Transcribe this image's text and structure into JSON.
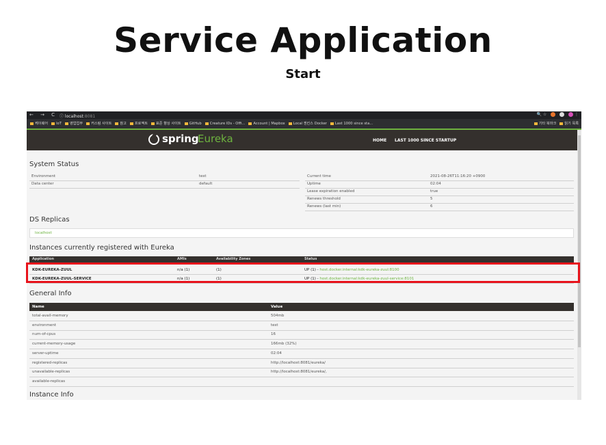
{
  "slide": {
    "title": "Service Application",
    "subtitle": "Start"
  },
  "browser": {
    "nav_glyphs": "← → C",
    "url_host": "localhost",
    "url_port": ":8081",
    "right_glyphs": "🔍 ☆",
    "bookmarks": [
      "케이웨어",
      "IoT",
      "영업업무",
      "커스텀 사이트",
      "참고",
      "프로젝트",
      "표준 향상 사이트",
      "GitHub",
      "Creature IDs - Offi...",
      "Account | Mapbox",
      "Local 젠킨스 Docker",
      "Last 1000 since sta..."
    ],
    "bookmarks_right": [
      "기타 북마크",
      "읽기 목록"
    ],
    "colors": {
      "folder": "#f6b93b",
      "accent": "#6db33f"
    }
  },
  "eureka": {
    "logo_spring": "spring",
    "logo_eureka": "Eureka",
    "nav": [
      "HOME",
      "LAST 1000 SINCE STARTUP"
    ],
    "system_status": {
      "heading": "System Status",
      "left": [
        {
          "key": "Environment",
          "value": "test"
        },
        {
          "key": "Data center",
          "value": "default"
        }
      ],
      "right": [
        {
          "key": "Current time",
          "value": "2021-08-26T11:16:20 +0900"
        },
        {
          "key": "Uptime",
          "value": "02:04"
        },
        {
          "key": "Lease expiration enabled",
          "value": "true"
        },
        {
          "key": "Renews threshold",
          "value": "5"
        },
        {
          "key": "Renews (last min)",
          "value": "6"
        }
      ]
    },
    "ds_replicas": {
      "heading": "DS Replicas",
      "item": "localhost"
    },
    "instances": {
      "heading": "Instances currently registered with Eureka",
      "columns": [
        "Application",
        "AMIs",
        "Availability Zones",
        "Status"
      ],
      "rows": [
        {
          "app": "KDK-EUREKA-ZUUL",
          "amis": "n/a (1)",
          "zones": "(1)",
          "status": "UP (1) - ",
          "link": "host.docker.internal:kdk-eureka-zuul:8100"
        },
        {
          "app": "KDK-EUREKA-ZUUL-SERVICE",
          "amis": "n/a (1)",
          "zones": "(1)",
          "status": "UP (1) - ",
          "link": "host.docker.internal:kdk-eureka-zuul-service:8101"
        }
      ]
    },
    "general_info": {
      "heading": "General Info",
      "columns": [
        "Name",
        "Value"
      ],
      "rows": [
        {
          "name": "total-avail-memory",
          "value": "504mb"
        },
        {
          "name": "environment",
          "value": "test"
        },
        {
          "name": "num-of-cpus",
          "value": "16"
        },
        {
          "name": "current-memory-usage",
          "value": "166mb (32%)"
        },
        {
          "name": "server-uptime",
          "value": "02:04"
        },
        {
          "name": "registered-replicas",
          "value": "http://localhost:8081/eureka/"
        },
        {
          "name": "unavailable-replicas",
          "value": "http://localhost:8081/eureka/,"
        },
        {
          "name": "available-replicas",
          "value": ""
        }
      ]
    },
    "instance_info": {
      "heading": "Instance Info"
    }
  },
  "highlight": {
    "color": "#e8121b"
  }
}
